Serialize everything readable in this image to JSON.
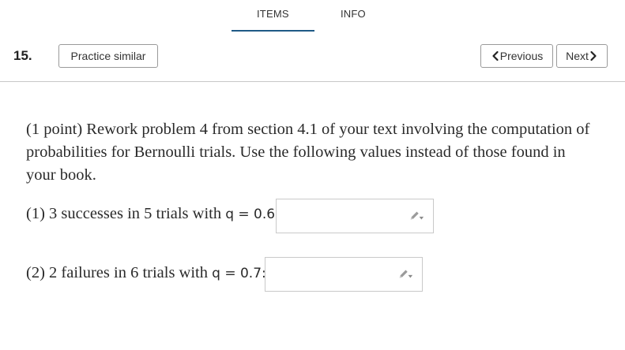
{
  "tabs": {
    "items_label": "ITEMS",
    "info_label": "INFO",
    "active": "ITEMS"
  },
  "question": {
    "number": "15.",
    "practice_label": "Practice similar",
    "prev_label": "Previous",
    "next_label": "Next"
  },
  "problem": {
    "text": "(1 point) Rework problem 4 from section 4.1 of your text involving the computation of probabilities for Bernoulli trials. Use the following values instead of those found in your book.",
    "part1_prefix": "(1) 3 successes in 5 trials with ",
    "part1_eq": "q = 0.6:",
    "part2_prefix": "(2) 2 failures in 6 trials with ",
    "part2_eq": "q = 0.7:",
    "answer1_value": "",
    "answer2_value": ""
  },
  "icons": {
    "previous": "chevron-left-icon",
    "next": "chevron-right-icon",
    "answer_entry": "pencil-dropdown-icon"
  },
  "colors": {
    "tab_underline": "#1f5a86",
    "button_border": "#9a9a9a",
    "divider": "#c8c8c8",
    "input_border": "#c9c9c9"
  }
}
